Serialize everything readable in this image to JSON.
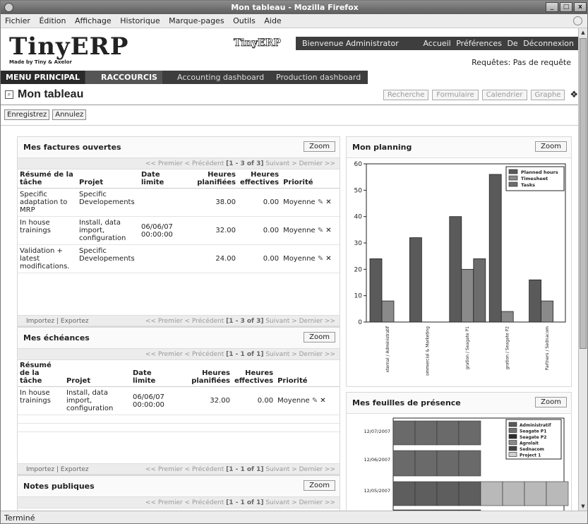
{
  "window": {
    "title": "Mon tableau - Mozilla Firefox",
    "buttons": [
      "_",
      "□",
      "x"
    ]
  },
  "menubar": [
    "Fichier",
    "Édition",
    "Affichage",
    "Historique",
    "Marque-pages",
    "Outils",
    "Aide"
  ],
  "status": "Terminé",
  "header": {
    "logo_main": "TinyERP",
    "logo_sub": "Made by   Tiny & Axelor",
    "logo_small": "TinyERP",
    "welcome": "Bienvenue Administrator",
    "links": [
      "Accueil",
      "Préférences",
      "De",
      "Déconnexion"
    ],
    "requests": "Requêtes: Pas de requête"
  },
  "mainbar": {
    "menu_principal": "MENU PRINCIPAL",
    "raccourcis": "RACCOURCIS",
    "shortcuts": [
      "Accounting dashboard",
      "Production dashboard"
    ]
  },
  "page": {
    "title": "Mon tableau",
    "view_buttons": [
      "Recherche",
      "Formulaire",
      "Calendrier",
      "Graphe"
    ],
    "help": "❖",
    "actions": [
      "Enregistrez",
      "Annulez"
    ]
  },
  "factures": {
    "title": "Mes factures ouvertes",
    "zoom": "Zoom",
    "pager_prefix": "<< Premier < Précédent ",
    "pager_range": "[1 - 3 of 3]",
    "pager_suffix": " Suivant > Dernier >>",
    "headers": [
      "Résumé de la tâche",
      "Projet",
      "Date limite",
      "Heures planifiées",
      "Heures effectives",
      "Priorité"
    ],
    "rows": [
      {
        "resume": "Specific adaptation to MRP",
        "projet": "Specific Developements",
        "date": "",
        "planned": "38.00",
        "effective": "0.00",
        "priority": "Moyenne"
      },
      {
        "resume": "In house trainings",
        "projet": "Install, data import, configuration",
        "date": "06/06/07 00:00:00",
        "planned": "32.00",
        "effective": "0.00",
        "priority": "Moyenne"
      },
      {
        "resume": "Validation + latest modifications.",
        "projet": "Specific Developements",
        "date": "",
        "planned": "24.00",
        "effective": "0.00",
        "priority": "Moyenne"
      }
    ],
    "import_export": "Importez | Exportez"
  },
  "echeances": {
    "title": "Mes échéances",
    "zoom": "Zoom",
    "pager_prefix": "<< Premier < Précédent ",
    "pager_range": "[1 - 1 of 1]",
    "pager_suffix": " Suivant > Dernier >>",
    "headers": [
      "Résumé de la tâche",
      "Projet",
      "Date limite",
      "Heures planifiées",
      "Heures effectives",
      "Priorité"
    ],
    "rows": [
      {
        "resume": "In house trainings",
        "projet": "Install, data import, configuration",
        "date": "06/06/07 00:00:00",
        "planned": "32.00",
        "effective": "0.00",
        "priority": "Moyenne"
      }
    ],
    "import_export": "Importez | Exportez"
  },
  "notes": {
    "title": "Notes publiques",
    "zoom": "Zoom",
    "pager_prefix": "<< Premier < Précédent ",
    "pager_range": "[1 - 1 of 1]",
    "pager_suffix": " Suivant > Dernier >>"
  },
  "planning": {
    "title": "Mon planning",
    "zoom": "Zoom"
  },
  "presence": {
    "title": "Mes feuilles de présence",
    "zoom": "Zoom"
  },
  "colors": {
    "dark_bar": "#3d3d3d",
    "planned": "#5a5a5a",
    "timesheet": "#8a8a8a",
    "tasks": "#6c6c6c"
  },
  "chart_data": [
    {
      "type": "bar",
      "categories": [
        "xternal / Administratif",
        "ommercial & Marketing",
        "gration / Seagate P1",
        "gration / Seagate P2",
        "Partners / Sednacom"
      ],
      "series": [
        {
          "name": "Planned hours",
          "values": [
            24,
            32,
            40,
            56,
            16
          ]
        },
        {
          "name": "Timesheet",
          "values": [
            8,
            0,
            20,
            4,
            8
          ]
        },
        {
          "name": "Tasks",
          "values": [
            0,
            0,
            24,
            0,
            0
          ]
        }
      ],
      "yticks": [
        "0",
        "10",
        "20",
        "30",
        "40",
        "50",
        "60"
      ],
      "ylim": [
        0,
        60
      ],
      "legend": "top-right"
    },
    {
      "type": "bar",
      "categories": [
        "12/07/2007",
        "12/06/2007",
        "12/05/2007"
      ],
      "series": [
        {
          "name": "Administratif",
          "values": []
        },
        {
          "name": "Seagate P1",
          "values": []
        },
        {
          "name": "Seagate P2",
          "values": []
        },
        {
          "name": "Agrolait",
          "values": []
        },
        {
          "name": "Sednacom",
          "values": []
        },
        {
          "name": "Project 1",
          "values": []
        }
      ],
      "legend": "top-right"
    }
  ]
}
